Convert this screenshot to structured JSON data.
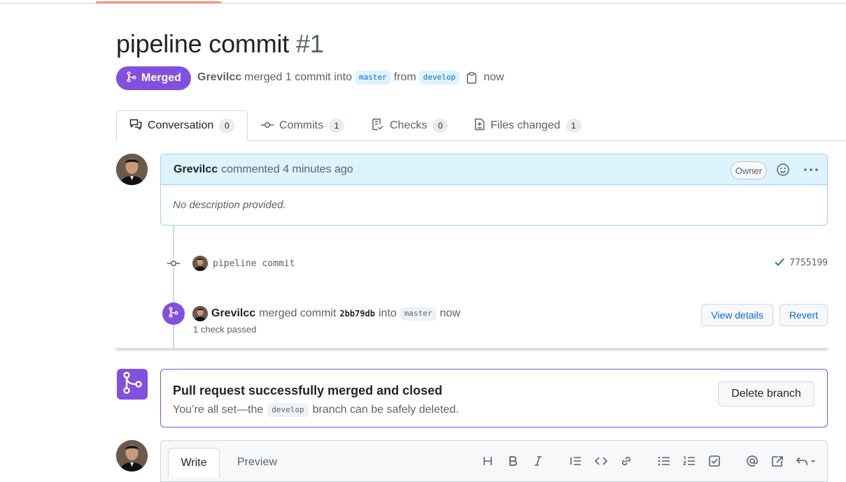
{
  "header": {
    "title": "pipeline commit",
    "number": "#1",
    "status": "Merged",
    "author": "Grevilcc",
    "merge_text": "merged 1 commit into",
    "base_branch": "master",
    "from_text": "from",
    "head_branch": "develop",
    "time": "now"
  },
  "tabs": [
    {
      "label": "Conversation",
      "count": "0"
    },
    {
      "label": "Commits",
      "count": "1"
    },
    {
      "label": "Checks",
      "count": "0"
    },
    {
      "label": "Files changed",
      "count": "1"
    }
  ],
  "comment": {
    "author": "Grevilcc",
    "action": "commented 4 minutes ago",
    "role": "Owner",
    "body": "No description provided."
  },
  "commit_event": {
    "message": "pipeline commit",
    "sha": "7755199"
  },
  "merge_event": {
    "author": "Grevilcc",
    "text1": "merged commit",
    "sha": "2bb79db",
    "text2": "into",
    "branch": "master",
    "time": "now",
    "checks": "1 check passed",
    "view_details": "View details",
    "revert": "Revert"
  },
  "merged_box": {
    "title": "Pull request successfully merged and closed",
    "sub_prefix": "You’re all set—the",
    "branch": "develop",
    "sub_suffix": "branch can be safely deleted.",
    "delete_button": "Delete branch"
  },
  "editor": {
    "write_tab": "Write",
    "preview_tab": "Preview",
    "toolbar": [
      "heading-icon",
      "bold-icon",
      "italic-icon",
      "quote-icon",
      "code-icon",
      "link-icon",
      "unordered-list-icon",
      "ordered-list-icon",
      "task-list-icon",
      "mention-icon",
      "reference-icon",
      "reply-icon"
    ]
  },
  "colors": {
    "merged": "#8250df",
    "link": "#0969da",
    "tab_accent": "#fd8c73",
    "check": "#1a7f37"
  }
}
